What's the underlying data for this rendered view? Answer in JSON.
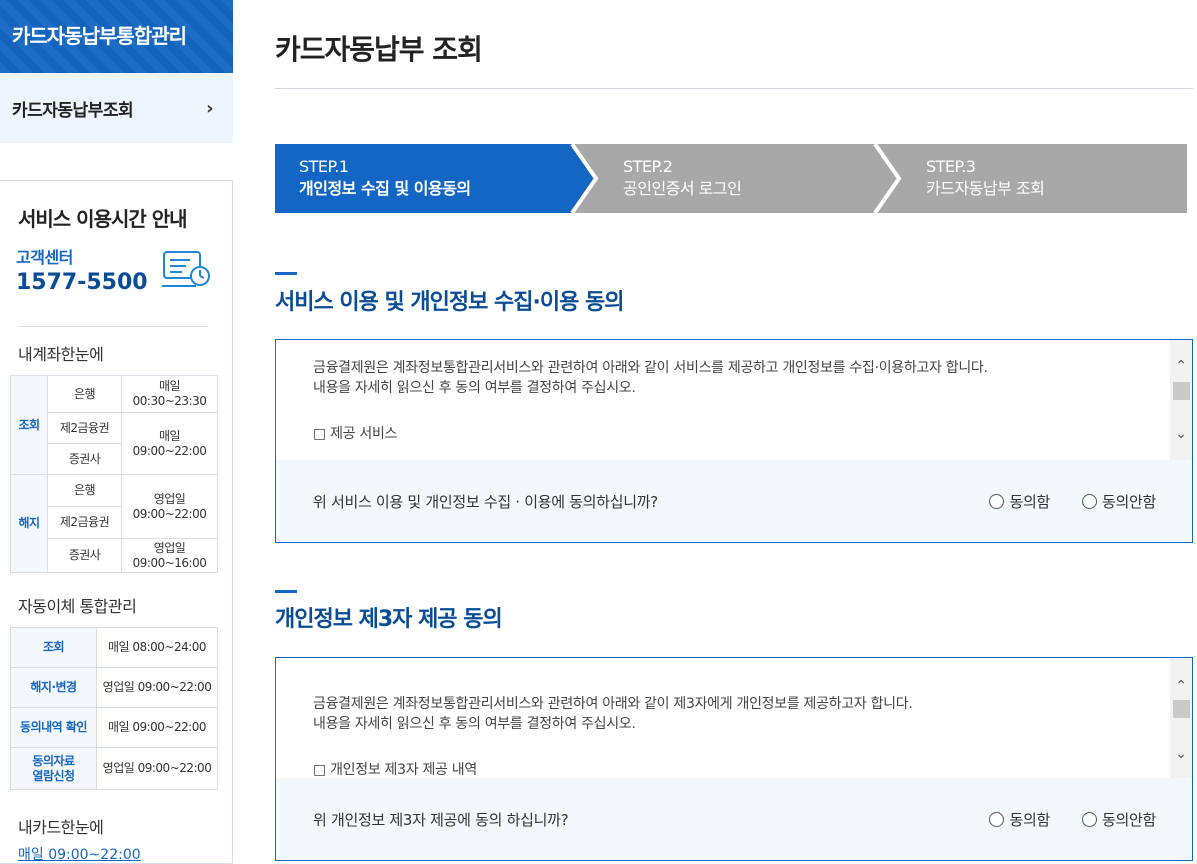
{
  "sidebar": {
    "title": "카드자동납부통합관리",
    "menu_item": "카드자동납부조회",
    "service_title": "서비스 이용시간 안내",
    "cs_label": "고객센터",
    "cs_number": "1577-5500",
    "sec1_title": "내계좌한눈에",
    "sec1_rows": {
      "cat_inquiry": "조회",
      "cat_cancel": "해지",
      "bank": "은행",
      "second": "제2금융권",
      "securities": "증권사",
      "daily": "매일",
      "business_day": "영업일",
      "t1": "00:30~23:30",
      "t2": "09:00~22:00",
      "t3": "09:00~22:00",
      "t4": "09:00~16:00"
    },
    "sec2_title": "자동이체 통합관리",
    "sec2_rows": [
      {
        "cat": "조회",
        "time": "매일 08:00~24:00"
      },
      {
        "cat": "해지·변경",
        "time": "영업일 09:00~22:00"
      },
      {
        "cat": "동의내역 확인",
        "time": "매일 09:00~22:00"
      },
      {
        "cat_l1": "동의자료",
        "cat_l2": "열람신청",
        "time": "영업일 09:00~22:00"
      }
    ],
    "sec3_title": "내카드한눈에",
    "sec3_hours": "매일 09:00~22:00"
  },
  "main": {
    "page_title": "카드자동납부 조회",
    "steps": [
      {
        "num": "STEP.1",
        "label": "개인정보 수집 및 이용동의"
      },
      {
        "num": "STEP.2",
        "label": "공인인증서 로그인"
      },
      {
        "num": "STEP.3",
        "label": "카드자동납부 조회"
      }
    ],
    "section1": {
      "heading": "서비스 이용 및 개인정보 수집·이용 동의",
      "line1": "금융결제원은 계좌정보통합관리서비스와 관련하여 아래와 같이 서비스를 제공하고 개인정보를 수집·이용하고자 합니다.",
      "line2": "내용을 자세히 읽으신 후 동의 여부를 결정하여 주십시오.",
      "item": "□ 제공 서비스",
      "question": "위 서비스 이용 및 개인정보 수집 · 이용에 동의하십니까?",
      "agree": "동의함",
      "disagree": "동의안함"
    },
    "section2": {
      "heading": "개인정보 제3자 제공 동의",
      "line1": "금융결제원은 계좌정보통합관리서비스와 관련하여 아래와 같이 제3자에게 개인정보를 제공하고자 합니다.",
      "line2": "내용을 자세히 읽으신 후 동의 여부를 결정하여 주십시오.",
      "item": "□ 개인정보 제3자 제공 내역",
      "question": "위 개인정보 제3자 제공에 동의 하십니까?",
      "agree": "동의함",
      "disagree": "동의안함"
    }
  },
  "colors": {
    "primary": "#1466c4",
    "step_inactive": "#a8a8a8",
    "question_bg": "#f2f8fc"
  }
}
